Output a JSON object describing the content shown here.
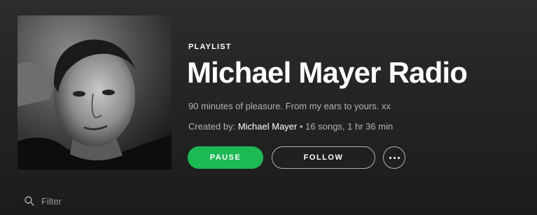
{
  "playlist": {
    "type_label": "PLAYLIST",
    "title": "Michael Mayer Radio",
    "description": "90 minutes of pleasure. From my ears to yours. xx",
    "created_by_label": "Created by:",
    "owner": "Michael Mayer",
    "separator": "•",
    "stats": "16 songs, 1 hr 36 min"
  },
  "actions": {
    "pause_label": "PAUSE",
    "follow_label": "FOLLOW",
    "more_icon": "more-dots-icon"
  },
  "filter": {
    "placeholder": "Filter",
    "value": "",
    "icon": "search-icon"
  },
  "colors": {
    "accent": "#1db954",
    "background": "#242424",
    "text_primary": "#ffffff",
    "text_secondary": "#b3b3b3"
  }
}
